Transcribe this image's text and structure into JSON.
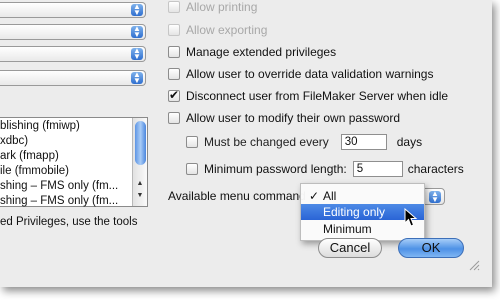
{
  "left_pane": {
    "list_items": [
      "blishing (fmiwp)",
      "xdbc)",
      "ark (fmapp)",
      "ile (fmmobile)",
      "shing – FMS only (fm...",
      "shing – FMS only (fm..."
    ],
    "note": "ed Privileges, use the tools"
  },
  "options": [
    {
      "label": "Allow printing",
      "checked": false,
      "dimmed": true
    },
    {
      "label": "Allow exporting",
      "checked": false,
      "dimmed": true
    },
    {
      "label": "Manage extended privileges",
      "checked": false,
      "dimmed": false
    },
    {
      "label": "Allow user to override data validation warnings",
      "checked": false,
      "dimmed": false
    },
    {
      "label": "Disconnect user from FileMaker Server when idle",
      "checked": true,
      "dimmed": false
    },
    {
      "label": "Allow user to modify their own password",
      "checked": false,
      "dimmed": false
    }
  ],
  "password": {
    "change_label": "Must be changed every",
    "change_value": "30",
    "change_unit": "days",
    "minlen_label": "Minimum password length:",
    "minlen_value": "5",
    "minlen_unit": "characters"
  },
  "menu_commands": {
    "label": "Available menu command",
    "options": [
      "All",
      "Editing only",
      "Minimum"
    ],
    "selected": "All",
    "highlighted": "Editing only"
  },
  "buttons": {
    "cancel": "Cancel",
    "ok": "OK"
  },
  "icons": {
    "stepper": "updown-arrows-icon",
    "check": "checkmark-icon",
    "cursor": "pointer-cursor-icon",
    "grip": "resize-grip-icon"
  },
  "colors": {
    "accent": "#2a64d6",
    "window_bg": "#ececec"
  }
}
